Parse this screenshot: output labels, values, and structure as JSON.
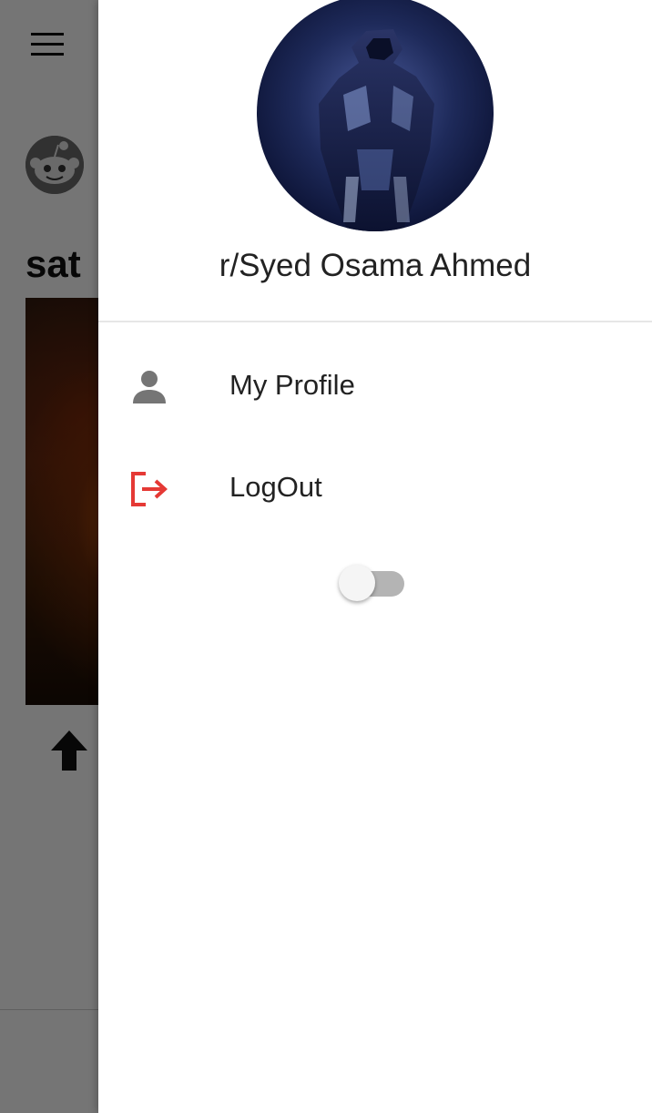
{
  "background": {
    "menu_icon": "hamburger-menu-icon",
    "avatar_icon": "reddit-alien-icon",
    "post_title": "sat",
    "upvote_icon": "upvote-arrow-icon"
  },
  "drawer": {
    "username": "r/Syed Osama Ahmed",
    "items": [
      {
        "label": "My Profile",
        "icon": "person-icon",
        "icon_color": "#757575"
      },
      {
        "label": "LogOut",
        "icon": "logout-icon",
        "icon_color": "#e53935"
      }
    ],
    "toggle": {
      "on": false
    }
  },
  "colors": {
    "scrim": "rgba(0,0,0,0.54)",
    "logout_accent": "#e53935",
    "text": "#222222"
  }
}
